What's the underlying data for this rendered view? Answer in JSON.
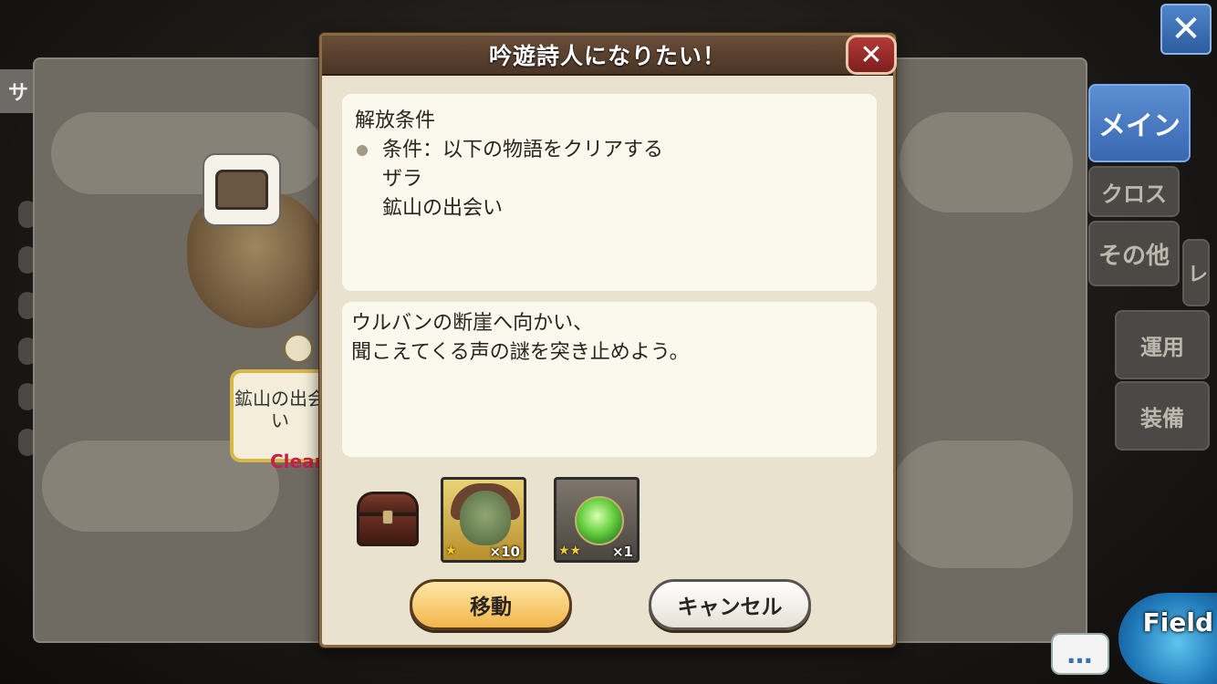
{
  "background": {
    "top_left_tab": "サ",
    "stage_card_text": "鉱山の出会い",
    "stage_status": "Clear",
    "tabs": {
      "main": "メイン",
      "cross": "クロス",
      "other": "その他",
      "hidden": "レ",
      "ops": "運用",
      "equip": "装備"
    },
    "close_icon": "close-x",
    "chat_label": "…",
    "field_label": "Field"
  },
  "dialog": {
    "title": "吟遊詩人になりたい！",
    "close_icon": "close-x",
    "conditions": {
      "heading": "解放条件",
      "items": [
        "条件：以下の物語をクリアする",
        "ザラ",
        "鉱山の出会い"
      ]
    },
    "description_lines": [
      "ウルバンの断崖へ向かい、",
      "聞こえてくる声の謎を突き止めよう。"
    ],
    "rewards": [
      {
        "icon": "treasure-chest",
        "stars": "",
        "qty": ""
      },
      {
        "icon": "character-portrait",
        "stars": "★",
        "qty": "×10"
      },
      {
        "icon": "green-orb",
        "stars": "★★",
        "qty": "×1"
      }
    ],
    "buttons": {
      "move": "移動",
      "cancel": "キャンセル"
    }
  },
  "colors": {
    "main_tab_blue": "#3868b0",
    "dialog_header": "#4a3526",
    "close_red": "#7e1f1e",
    "move_button": "#f3b64c",
    "clear_text": "#c2224a"
  }
}
